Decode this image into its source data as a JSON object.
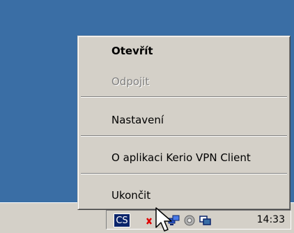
{
  "context_menu": {
    "items": [
      {
        "label": "Otevřít",
        "style": "default"
      },
      {
        "label": "Odpojit",
        "style": "disabled"
      },
      {
        "label": "Nastavení",
        "style": "normal"
      },
      {
        "label": "O aplikaci Kerio VPN Client",
        "style": "normal"
      },
      {
        "label": "Ukončit",
        "style": "normal"
      }
    ]
  },
  "taskbar": {
    "language_indicator": "CS",
    "tray_icons": [
      "kerio-disconnected-icon",
      "network-icon",
      "volume-icon",
      "display-icon"
    ],
    "clock": "14:33"
  },
  "colors": {
    "desktop": "#3a6ea5",
    "face": "#d4d0c8",
    "disabled_text": "#808080",
    "highlight": "#0a246a"
  }
}
